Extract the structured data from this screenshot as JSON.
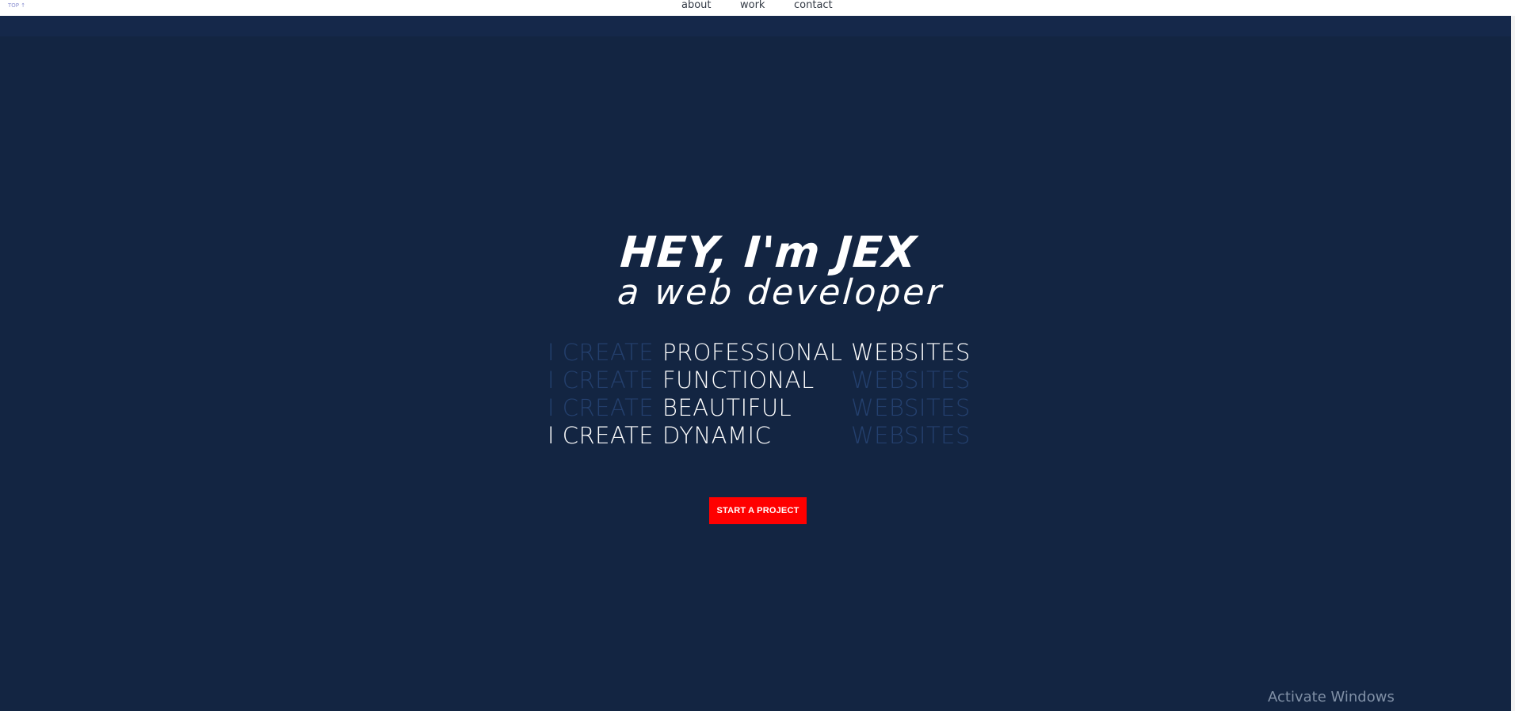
{
  "topbar": {
    "top_link": "TOP ↑",
    "nav": {
      "about": "about",
      "work": "work",
      "contact": "contact"
    }
  },
  "hero": {
    "headline_line1": "HEY, I'm JEX",
    "headline_line2": "a web developer",
    "rows": [
      {
        "lead": "I CREATE",
        "adjective": "PROFESSIONAL",
        "tail": "WEBSITES"
      },
      {
        "lead": "I CREATE",
        "adjective": "FUNCTIONAL",
        "tail": "WEBSITES"
      },
      {
        "lead": "I CREATE",
        "adjective": "BEAUTIFUL",
        "tail": "WEBSITES"
      },
      {
        "lead": "I CREATE",
        "adjective": "DYNAMIC",
        "tail": "WEBSITES"
      }
    ],
    "cta_label": "START A PROJECT"
  },
  "watermark": "Activate Windows",
  "colors": {
    "hero_bg": "#132542",
    "accent_red": "#ff0000",
    "dim_text": "#24406e",
    "bright_text": "#ffffff"
  }
}
